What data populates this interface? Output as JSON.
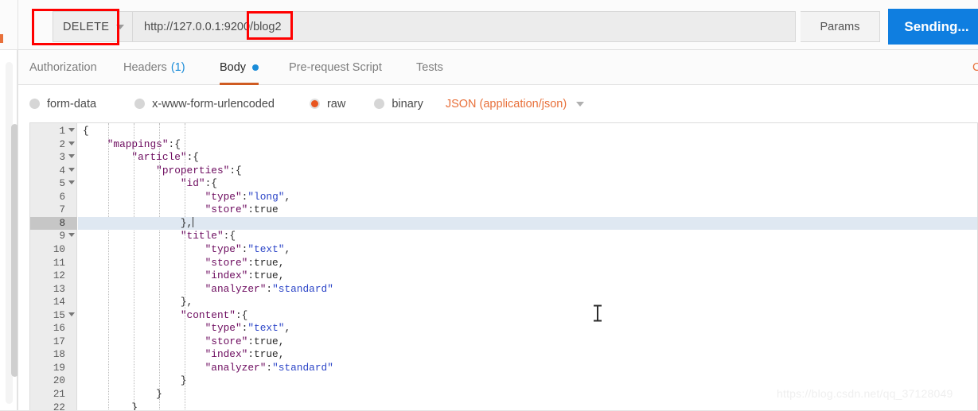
{
  "request": {
    "method": "DELETE",
    "method_caret_icon": "chevron-down-icon",
    "url_full": "http://127.0.0.1:9200/blog2",
    "url_base": "http://127.0.0.1:9200/",
    "url_highlighted_segment": "blog2",
    "params_label": "Params",
    "send_label": "Sending..."
  },
  "tabs": [
    {
      "label": "Authorization",
      "active": false,
      "count": "",
      "dot": false
    },
    {
      "label": "Headers",
      "active": false,
      "count": "(1)",
      "dot": false
    },
    {
      "label": "Body",
      "active": true,
      "count": "",
      "dot": true
    },
    {
      "label": "Pre-request Script",
      "active": false,
      "count": "",
      "dot": false
    },
    {
      "label": "Tests",
      "active": false,
      "count": "",
      "dot": false
    }
  ],
  "code_link_label": "C",
  "body_types": [
    {
      "label": "form-data",
      "selected": false
    },
    {
      "label": "x-www-form-urlencoded",
      "selected": false
    },
    {
      "label": "raw",
      "selected": true
    },
    {
      "label": "binary",
      "selected": false
    }
  ],
  "content_type": {
    "label": "JSON (application/json)",
    "caret_icon": "chevron-down-icon"
  },
  "editor": {
    "active_line": 8,
    "cursor_line": 8,
    "lines": [
      {
        "n": 1,
        "fold": true,
        "tokens": [
          {
            "t": "{",
            "c": "punct"
          }
        ]
      },
      {
        "n": 2,
        "fold": true,
        "tokens": [
          {
            "t": "    \"mappings\"",
            "c": "key"
          },
          {
            "t": ":{",
            "c": "punct"
          }
        ]
      },
      {
        "n": 3,
        "fold": true,
        "tokens": [
          {
            "t": "        \"article\"",
            "c": "key"
          },
          {
            "t": ":{",
            "c": "punct"
          }
        ]
      },
      {
        "n": 4,
        "fold": true,
        "tokens": [
          {
            "t": "            \"properties\"",
            "c": "key"
          },
          {
            "t": ":{",
            "c": "punct"
          }
        ]
      },
      {
        "n": 5,
        "fold": true,
        "tokens": [
          {
            "t": "                \"id\"",
            "c": "key"
          },
          {
            "t": ":{",
            "c": "punct"
          }
        ]
      },
      {
        "n": 6,
        "fold": false,
        "tokens": [
          {
            "t": "                    \"type\"",
            "c": "key"
          },
          {
            "t": ":",
            "c": "punct"
          },
          {
            "t": "\"long\"",
            "c": "str"
          },
          {
            "t": ",",
            "c": "punct"
          }
        ]
      },
      {
        "n": 7,
        "fold": false,
        "tokens": [
          {
            "t": "                    \"store\"",
            "c": "key"
          },
          {
            "t": ":true",
            "c": "plain"
          }
        ]
      },
      {
        "n": 8,
        "fold": false,
        "tokens": [
          {
            "t": "                },",
            "c": "punct"
          }
        ]
      },
      {
        "n": 9,
        "fold": true,
        "tokens": [
          {
            "t": "                \"title\"",
            "c": "key"
          },
          {
            "t": ":{",
            "c": "punct"
          }
        ]
      },
      {
        "n": 10,
        "fold": false,
        "tokens": [
          {
            "t": "                    \"type\"",
            "c": "key"
          },
          {
            "t": ":",
            "c": "punct"
          },
          {
            "t": "\"text\"",
            "c": "str"
          },
          {
            "t": ",",
            "c": "punct"
          }
        ]
      },
      {
        "n": 11,
        "fold": false,
        "tokens": [
          {
            "t": "                    \"store\"",
            "c": "key"
          },
          {
            "t": ":true,",
            "c": "plain"
          }
        ]
      },
      {
        "n": 12,
        "fold": false,
        "tokens": [
          {
            "t": "                    \"index\"",
            "c": "key"
          },
          {
            "t": ":true,",
            "c": "plain"
          }
        ]
      },
      {
        "n": 13,
        "fold": false,
        "tokens": [
          {
            "t": "                    \"analyzer\"",
            "c": "key"
          },
          {
            "t": ":",
            "c": "punct"
          },
          {
            "t": "\"standard\"",
            "c": "str"
          }
        ]
      },
      {
        "n": 14,
        "fold": false,
        "tokens": [
          {
            "t": "                },",
            "c": "punct"
          }
        ]
      },
      {
        "n": 15,
        "fold": true,
        "tokens": [
          {
            "t": "                \"content\"",
            "c": "key"
          },
          {
            "t": ":{",
            "c": "punct"
          }
        ]
      },
      {
        "n": 16,
        "fold": false,
        "tokens": [
          {
            "t": "                    \"type\"",
            "c": "key"
          },
          {
            "t": ":",
            "c": "punct"
          },
          {
            "t": "\"text\"",
            "c": "str"
          },
          {
            "t": ",",
            "c": "punct"
          }
        ]
      },
      {
        "n": 17,
        "fold": false,
        "tokens": [
          {
            "t": "                    \"store\"",
            "c": "key"
          },
          {
            "t": ":true,",
            "c": "plain"
          }
        ]
      },
      {
        "n": 18,
        "fold": false,
        "tokens": [
          {
            "t": "                    \"index\"",
            "c": "key"
          },
          {
            "t": ":true,",
            "c": "plain"
          }
        ]
      },
      {
        "n": 19,
        "fold": false,
        "tokens": [
          {
            "t": "                    \"analyzer\"",
            "c": "key"
          },
          {
            "t": ":",
            "c": "punct"
          },
          {
            "t": "\"standard\"",
            "c": "str"
          }
        ]
      },
      {
        "n": 20,
        "fold": false,
        "tokens": [
          {
            "t": "                }",
            "c": "punct"
          }
        ]
      },
      {
        "n": 21,
        "fold": false,
        "tokens": [
          {
            "t": "            }",
            "c": "punct"
          }
        ]
      },
      {
        "n": 22,
        "fold": false,
        "tokens": [
          {
            "t": "        }",
            "c": "punct"
          }
        ]
      }
    ]
  },
  "watermark": "https://blog.csdn.net/qq_37128049",
  "colors": {
    "send_button": "#0f7ee0",
    "annotation_box": "#ff0000",
    "active_tab_underline": "#cf5b22",
    "body_dot": "#1a8cd8",
    "raw_radio": "#e8551f",
    "content_type_text": "#e8703a",
    "active_line_bg": "#dfe8f2",
    "json_key": "#6c0a5e",
    "json_string": "#2b44c7"
  }
}
